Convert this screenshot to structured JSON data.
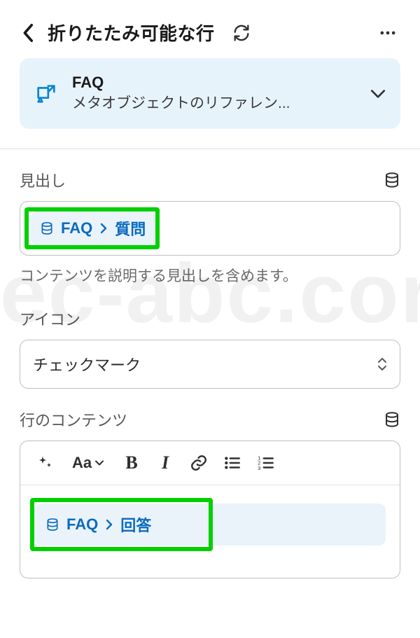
{
  "header": {
    "title": "折りたたみ可能な行"
  },
  "reference_card": {
    "title": "FAQ",
    "subtitle": "メタオブジェクトのリファレン..."
  },
  "heading_field": {
    "label": "見出し",
    "pill_source": "FAQ",
    "pill_field": "質問",
    "help": "コンテンツを説明する見出しを含めます。"
  },
  "icon_field": {
    "label": "アイコン",
    "selected": "チェックマーク"
  },
  "content_field": {
    "label": "行のコンテンツ",
    "pill_source": "FAQ",
    "pill_field": "回答"
  },
  "highlight_color": "#00d000",
  "watermark_text": "ec-abc.con"
}
